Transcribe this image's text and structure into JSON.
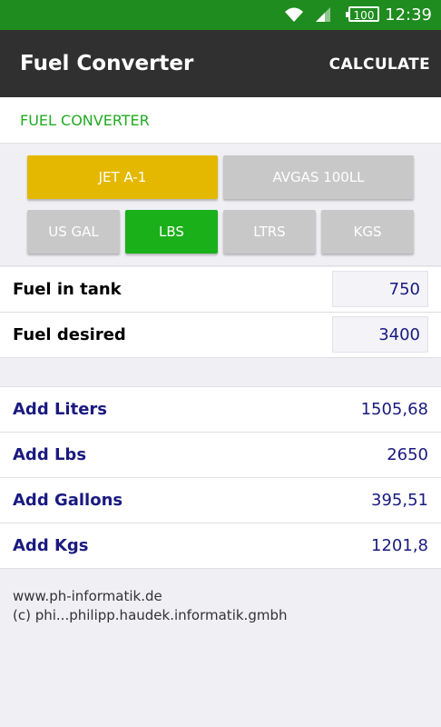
{
  "status_bar": {
    "battery": "100",
    "time": "12:39",
    "wifi_icon": "wifi-icon",
    "signal_icon": "signal-icon"
  },
  "app_bar": {
    "title": "Fuel Converter",
    "action_label": "CALCULATE"
  },
  "section": {
    "header": "FUEL CONVERTER"
  },
  "fuel_types": [
    {
      "label": "JET A-1",
      "selected": true,
      "color": "#e5b800"
    },
    {
      "label": "AVGAS 100LL",
      "selected": false,
      "color": "#c8c8c8"
    }
  ],
  "units": [
    {
      "label": "US GAL",
      "selected": false,
      "color": "#c8c8c8"
    },
    {
      "label": "LBS",
      "selected": true,
      "color": "#1ab01a"
    },
    {
      "label": "LTRS",
      "selected": false,
      "color": "#c8c8c8"
    },
    {
      "label": "KGS",
      "selected": false,
      "color": "#c8c8c8"
    }
  ],
  "inputs": [
    {
      "label": "Fuel in tank",
      "value": "750"
    },
    {
      "label": "Fuel desired",
      "value": "3400"
    }
  ],
  "results": [
    {
      "label": "Add Liters",
      "value": "1505,68"
    },
    {
      "label": "Add Lbs",
      "value": "2650"
    },
    {
      "label": "Add Gallons",
      "value": "395,51"
    },
    {
      "label": "Add Kgs",
      "value": "1201,8"
    }
  ],
  "footer": {
    "website": "www.ph-informatik.de",
    "copyright": "(c) phi...philipp.haudek.informatik.gmbh"
  }
}
